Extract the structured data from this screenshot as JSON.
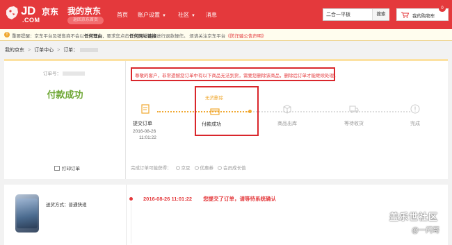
{
  "header": {
    "logo_text": "JD",
    "logo_com": ".COM",
    "logo_cn": "京东",
    "title": "我的京东",
    "back_home": "返回京东首页",
    "nav": [
      {
        "label": "首页",
        "dropdown": false
      },
      {
        "label": "账户设置",
        "dropdown": true
      },
      {
        "label": "社区",
        "dropdown": true
      },
      {
        "label": "消息",
        "dropdown": false
      }
    ],
    "search_value": "二合一平板",
    "search_button": "搜索",
    "cart_label": "我的购物车",
    "cart_count": "0",
    "brand_color": "#e4393c"
  },
  "notice": {
    "icon": "!",
    "prefix": "重要提醒：京东平台及销售商不会以",
    "bold1": "任何理由",
    "middle": "，要求您点击",
    "bold2": "任何网址链接",
    "suffix": "进行退款操作。 烦请关注京东平台",
    "link": "《防诈骗公告声明》"
  },
  "breadcrumb": {
    "items": [
      "我的京东",
      "订单中心",
      "订单："
    ],
    "separator": ">"
  },
  "order": {
    "number_label": "订单号：",
    "status": "付款成功",
    "alert": "尊敬的客户，非常遗憾您订单中有以下商品无法到货，需要您删除该商品，删除后订单才能继续处理。",
    "print_label": "打印订单",
    "no_stock_label": "无货删除",
    "rewards_label": "完成订单可能获得：",
    "rewards": [
      "京豆",
      "优惠券",
      "会员成长值"
    ]
  },
  "progress": {
    "steps": [
      {
        "label": "提交订单",
        "date": "2016-08-26",
        "time": "11:01:22",
        "icon": "document-icon",
        "done": true
      },
      {
        "label": "付款成功",
        "date": "",
        "time": "",
        "icon": "card-icon",
        "done": true
      },
      {
        "label": "商品出库",
        "date": "",
        "time": "",
        "icon": "box-icon",
        "done": false
      },
      {
        "label": "等待收货",
        "date": "",
        "time": "",
        "icon": "truck-icon",
        "done": false
      },
      {
        "label": "完成",
        "date": "",
        "time": "",
        "icon": "check-icon",
        "done": false
      }
    ],
    "done_color": "#f0a830",
    "pending_color": "#dddddd"
  },
  "shipment": {
    "method": "送货方式：普通快递",
    "log_time": "2016-08-26 11:01:22",
    "log_text": "您提交了订单，请等待系统确认"
  },
  "watermark": {
    "line1": "盖乐世社区",
    "line2": "@一闪哥"
  }
}
